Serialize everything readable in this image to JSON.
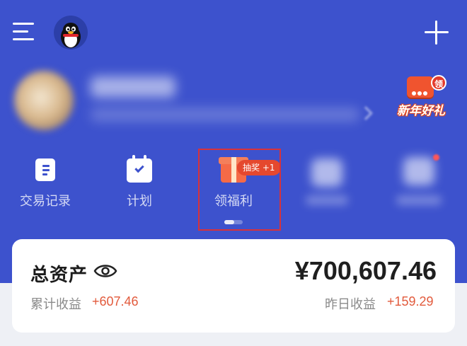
{
  "header": {
    "menu_icon": "hamburger-menu-icon",
    "avatar_icon": "penguin-avatar-icon",
    "add_icon": "plus-icon"
  },
  "promo": {
    "tag": "领",
    "label": "新年好礼"
  },
  "quick_menu": [
    {
      "label": "交易记录",
      "icon": "document-icon"
    },
    {
      "label": "计划",
      "icon": "calendar-check-icon"
    },
    {
      "label": "领福利",
      "icon": "gift-icon",
      "badge": "抽奖 +1"
    }
  ],
  "assets": {
    "title": "总资产",
    "total": "¥700,607.46",
    "cumulative_label": "累计收益",
    "cumulative_value": "+607.46",
    "yesterday_label": "昨日收益",
    "yesterday_value": "+159.29"
  },
  "colors": {
    "header_bg": "#3d52cd",
    "gain": "#e25a3c",
    "highlight": "#d8323a"
  }
}
